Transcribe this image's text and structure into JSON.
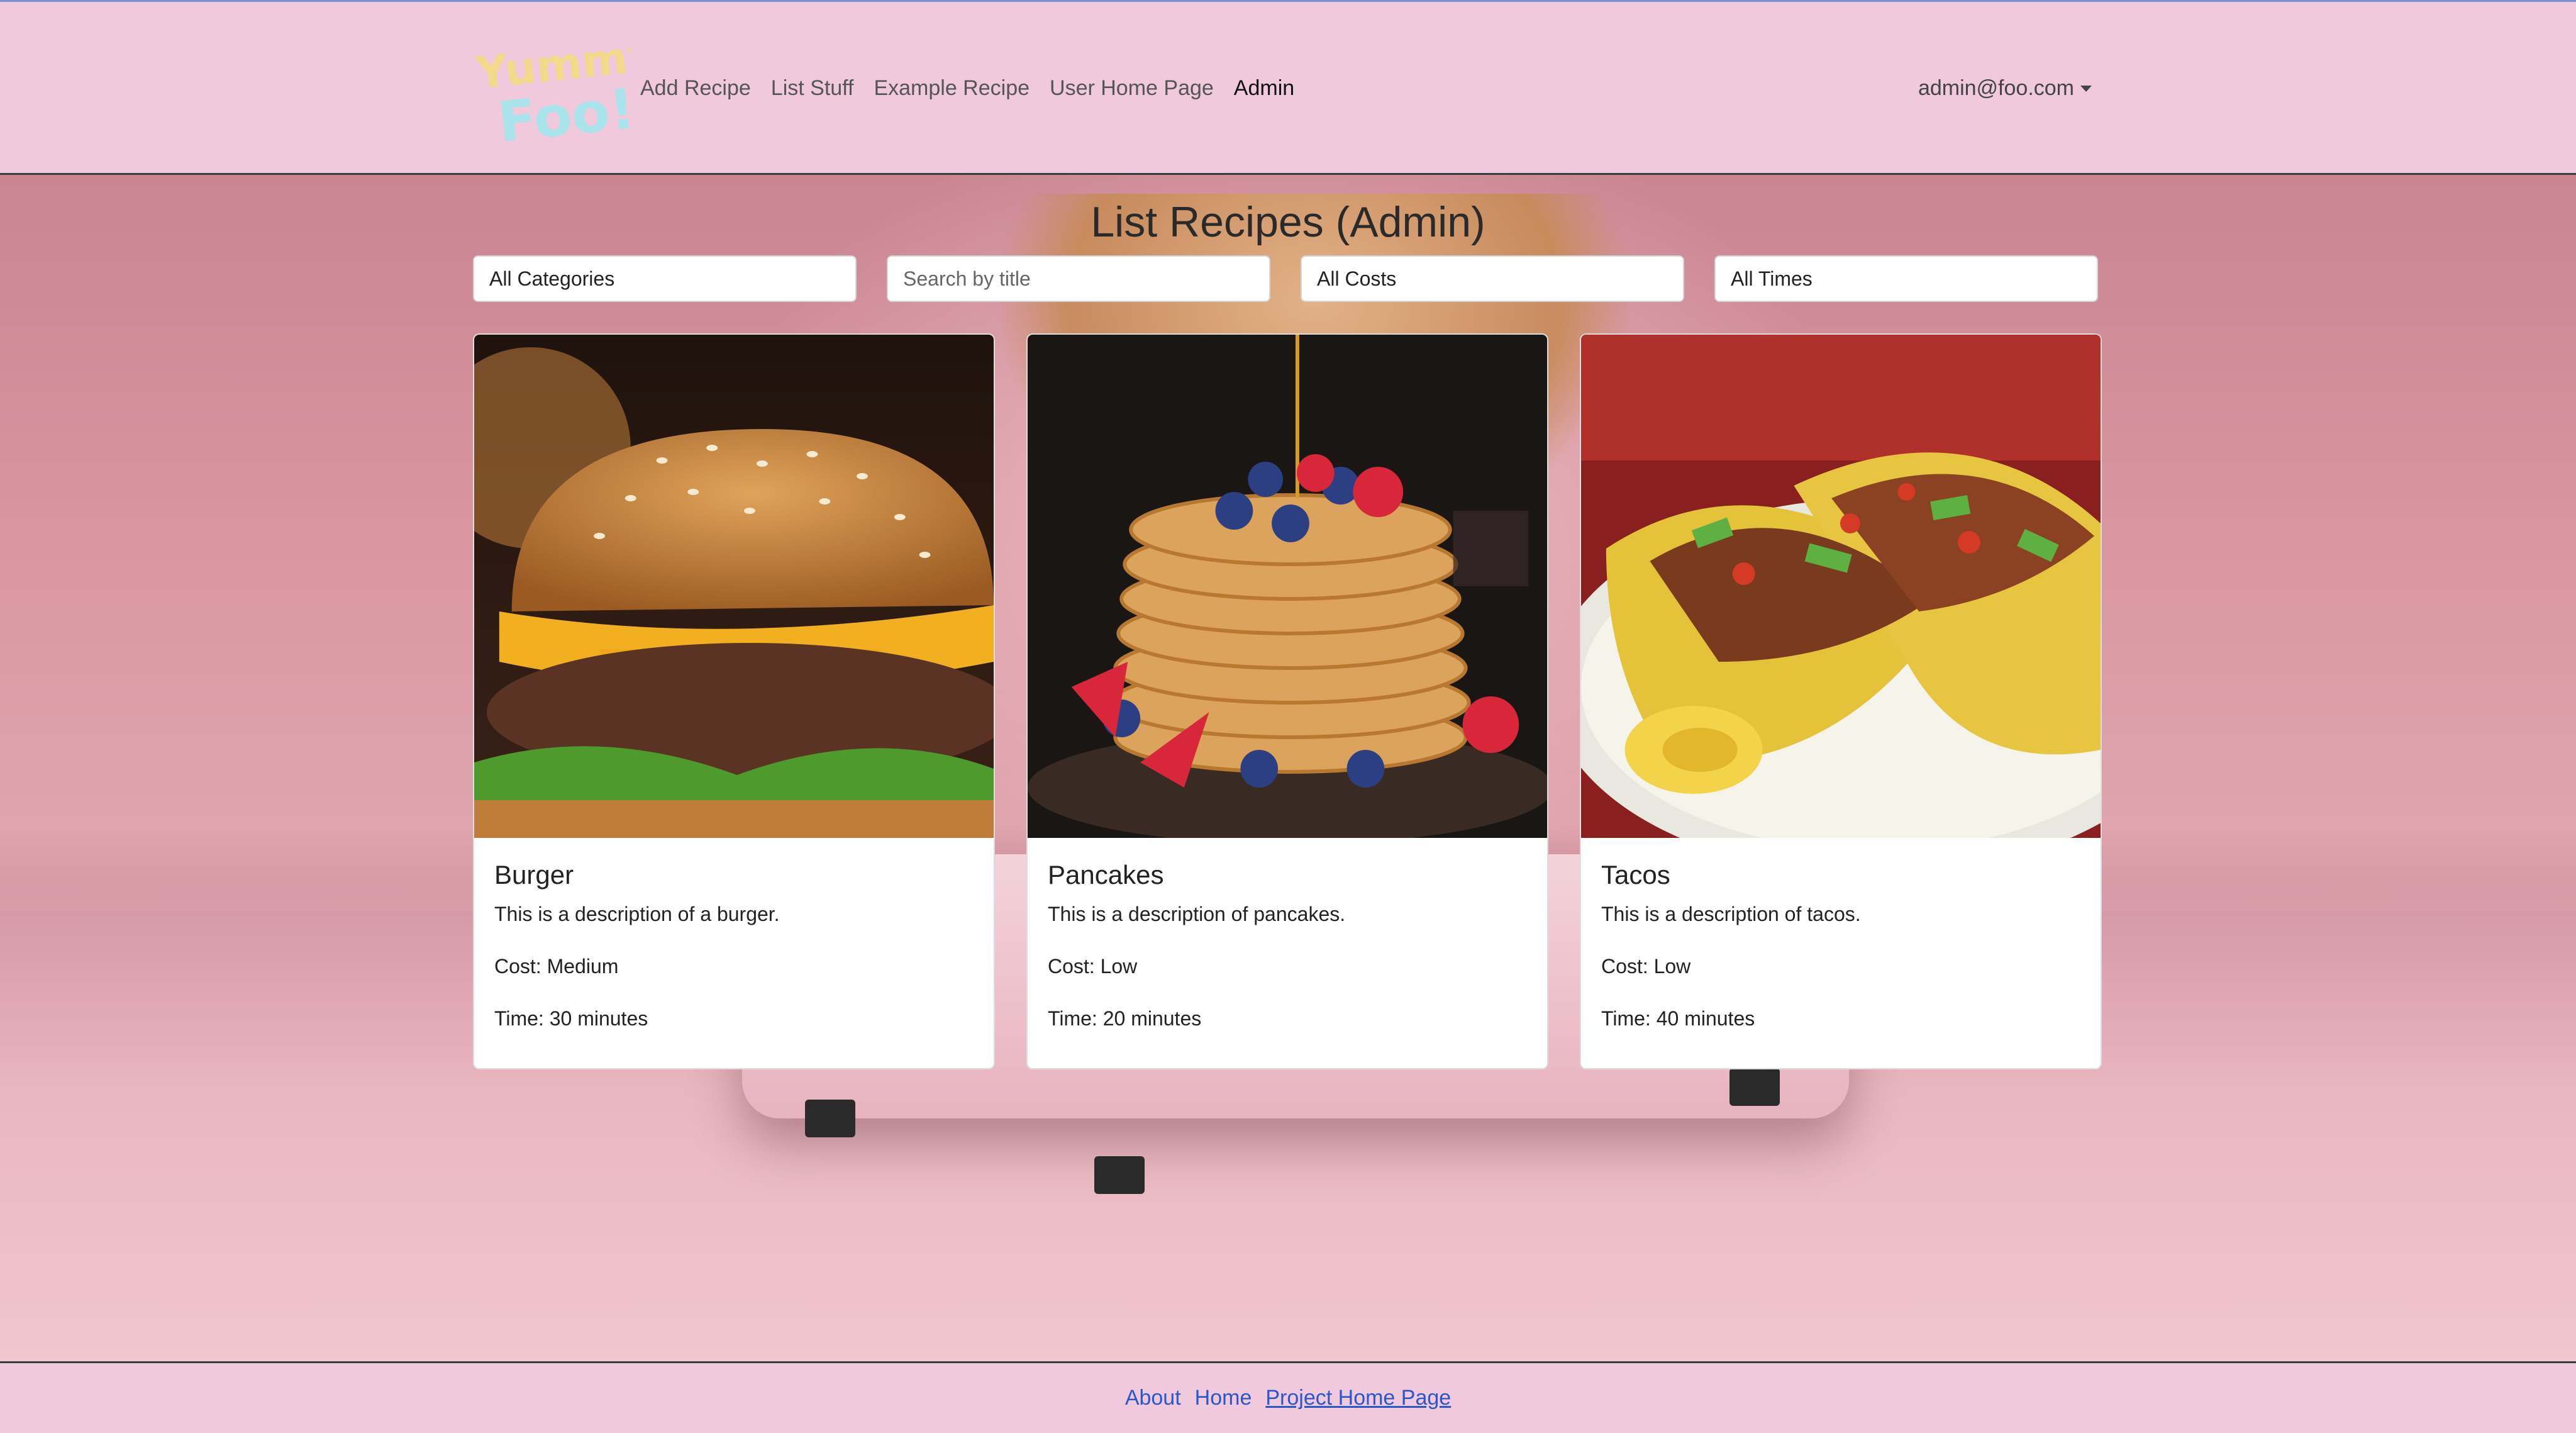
{
  "navbar": {
    "logo_text_top": "Yummy",
    "logo_text_bottom": "Foo!",
    "links": [
      {
        "label": "Add Recipe"
      },
      {
        "label": "List Stuff"
      },
      {
        "label": "Example Recipe"
      },
      {
        "label": "User Home Page"
      },
      {
        "label": "Admin"
      }
    ],
    "user": "admin@foo.com"
  },
  "main": {
    "title": "List Recipes (Admin)",
    "filters": {
      "category": "All Categories",
      "search_placeholder": "Search by title",
      "cost": "All Costs",
      "time": "All Times"
    },
    "cards": [
      {
        "title": "Burger",
        "description": "This is a description of a burger.",
        "cost": "Cost: Medium",
        "time": "Time: 30 minutes"
      },
      {
        "title": "Pancakes",
        "description": "This is a description of pancakes.",
        "cost": "Cost: Low",
        "time": "Time: 20 minutes"
      },
      {
        "title": "Tacos",
        "description": "This is a description of tacos.",
        "cost": "Cost: Low",
        "time": "Time: 40 minutes"
      }
    ]
  },
  "footer": {
    "about": "About",
    "home": "Home",
    "project": "Project Home Page"
  },
  "colors": {
    "nav_bg": "#f0c9dc",
    "link_blue": "#2a57c9"
  }
}
